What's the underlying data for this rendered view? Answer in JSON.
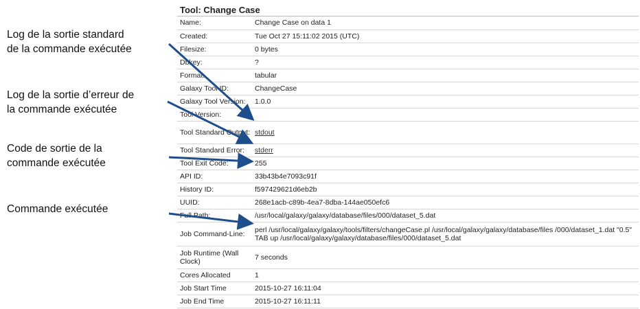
{
  "tool_title": "Tool: Change Case",
  "rows": [
    {
      "label": "Name:",
      "value": "Change Case on data 1"
    },
    {
      "label": "Created:",
      "value": "Tue Oct 27 15:11:02 2015 (UTC)"
    },
    {
      "label": "Filesize:",
      "value": "0 bytes"
    },
    {
      "label": "Dbkey:",
      "value": "?"
    },
    {
      "label": "Format:",
      "value": "tabular"
    },
    {
      "label": "Galaxy Tool ID:",
      "value": "ChangeCase"
    },
    {
      "label": "Galaxy Tool Version:",
      "value": "1.0.0"
    },
    {
      "label": "Tool Version:",
      "value": ""
    },
    {
      "label": "Tool Standard Output:",
      "value": "stdout"
    },
    {
      "label": "Tool Standard Error:",
      "value": "stderr"
    },
    {
      "label": "Tool Exit Code:",
      "value": "255"
    },
    {
      "label": "API ID:",
      "value": "33b43b4e7093c91f"
    },
    {
      "label": "History ID:",
      "value": "f597429621d6eb2b"
    },
    {
      "label": "UUID:",
      "value": "268e1acb-c89b-4ea7-8dba-144ae050efc6"
    },
    {
      "label": "Full Path:",
      "value": "/usr/local/galaxy/galaxy/database/files/000/dataset_5.dat"
    },
    {
      "label": "Job Command-Line:",
      "value": "perl /usr/local/galaxy/galaxy/tools/filters/changeCase.pl /usr/local/galaxy/galaxy/database/files /000/dataset_1.dat \"0.5\" TAB up /usr/local/galaxy/galaxy/database/files/000/dataset_5.dat"
    },
    {
      "label": "Job Runtime (Wall Clock)",
      "value": "7 seconds"
    },
    {
      "label": "Cores Allocated",
      "value": "1"
    },
    {
      "label": "Job Start Time",
      "value": "2015-10-27 16:11:04"
    },
    {
      "label": "Job End Time",
      "value": "2015-10-27 16:11:11"
    }
  ],
  "annotations": {
    "stdout_line1": "Log de la sortie standard",
    "stdout_line2": "de la commande exécutée",
    "stderr_line1": "Log de la sortie d’erreur de",
    "stderr_line2": "la commande exécutée",
    "exit_line1": "Code de sortie de la",
    "exit_line2": "commande exécutée",
    "cmd_line1": "Commande exécutée"
  },
  "colors": {
    "arrow": "#1f4e8c"
  }
}
